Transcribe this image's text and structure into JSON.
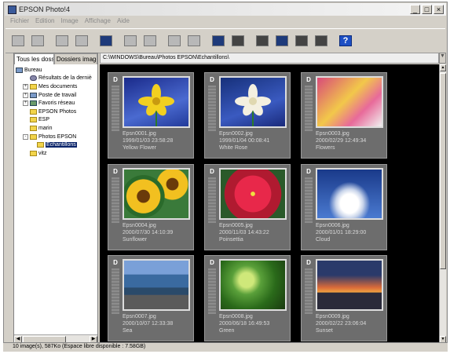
{
  "window": {
    "title": "EPSON Photo!4"
  },
  "menu": [
    "Fichier",
    "Edition",
    "Image",
    "Affichage",
    "Aide"
  ],
  "toolbar_icons": [
    "save-icon",
    "print-icon",
    "blank-icon",
    "copy-icon",
    "frame-icon",
    "prev-icon",
    "next-icon",
    "rotate-left-icon",
    "rotate-right-icon",
    "monitor-icon",
    "slideshow-icon",
    "small-thumbs-icon",
    "medium-thumbs-icon",
    "large-thumbs-icon",
    "list-icon",
    "help-icon"
  ],
  "help_label": "?",
  "tabs": [
    "Tous les dossi",
    "Dossiers image"
  ],
  "tree": [
    {
      "label": "Bureau",
      "icon": "pc",
      "depth": 0,
      "exp": ""
    },
    {
      "label": "Résultats de la derniè",
      "icon": "search",
      "depth": 1,
      "exp": ""
    },
    {
      "label": "Mes documents",
      "icon": "folder",
      "depth": 1,
      "exp": "+"
    },
    {
      "label": "Poste de travail",
      "icon": "pc",
      "depth": 1,
      "exp": "+"
    },
    {
      "label": "Favoris réseau",
      "icon": "net",
      "depth": 1,
      "exp": "+"
    },
    {
      "label": "EPSON Photos",
      "icon": "folder",
      "depth": 1,
      "exp": ""
    },
    {
      "label": "ESP",
      "icon": "folder",
      "depth": 1,
      "exp": ""
    },
    {
      "label": "marin",
      "icon": "folder",
      "depth": 1,
      "exp": ""
    },
    {
      "label": "Photos EPSON",
      "icon": "folder",
      "depth": 1,
      "exp": "-"
    },
    {
      "label": "Echantillons",
      "icon": "folder",
      "depth": 2,
      "exp": "",
      "selected": true
    },
    {
      "label": "vitz",
      "icon": "folder",
      "depth": 1,
      "exp": ""
    }
  ],
  "path": "C:\\WINDOWS\\Bureau\\Photos EPSON\\Echantillons\\",
  "images": [
    {
      "file": "Epsn0001.jpg",
      "date": "1999/01/03  23:58:28",
      "caption": "Yellow Flower",
      "bg": "linear-gradient(160deg,#1a2a8a,#4a6ad0 60%,#223a9a)",
      "subject": "yellow"
    },
    {
      "file": "Epsn0002.jpg",
      "date": "1999/01/04  00:08:41",
      "caption": "White Rose",
      "bg": "linear-gradient(160deg,#16307a,#3a5ac0 60%,#1a2a7a)",
      "subject": "white"
    },
    {
      "file": "Epsn0003.jpg",
      "date": "2000/02/29  12:49:34",
      "caption": "Flowers",
      "bg": "linear-gradient(135deg,#d84a7a,#f2c84a 45%,#e86a9a 70%,#f0f0f0)",
      "subject": "none"
    },
    {
      "file": "Epsn0004.jpg",
      "date": "2000/07/30  14:10:39",
      "caption": "Sunflower",
      "bg": "radial-gradient(circle at 30% 55%,#6a3a0a 0 12%,#f2c020 13% 32%,#2a6a2a 33% 40%,transparent 41%),radial-gradient(circle at 75% 30%,#6a3a0a 0 10%,#f2c020 11% 26%,transparent 27%),#3a7a3a",
      "subject": "none"
    },
    {
      "file": "Epsn0005.jpg",
      "date": "2000/11/03  14:43:22",
      "caption": "Poinsettia",
      "bg": "radial-gradient(circle at 50% 50%,#f0e040 0 5%,#e8284a 6% 45%,#b01a30 46% 70%,#2a5a2a 71%)",
      "subject": "none"
    },
    {
      "file": "Epsn0006.jpg",
      "date": "2000/01/01  18:29:00",
      "caption": "Cloud",
      "bg": "radial-gradient(ellipse at 50% 70%,#ffffff 0 20%,#c8d4ea 30%,transparent 45%),linear-gradient(180deg,#1a3a8a,#4a7ad0)",
      "subject": "none"
    },
    {
      "file": "Epsn0007.jpg",
      "date": "2000/10/07  12:33:38",
      "caption": "Sea",
      "bg": "linear-gradient(180deg,#7aa0d8 0 28%,#3a6aa0 29% 55%,#2a4a6a 56% 70%,#5a5a5a 71%)",
      "subject": "none"
    },
    {
      "file": "Epsn0008.jpg",
      "date": "2000/06/18  16:49:53",
      "caption": "Green",
      "bg": "radial-gradient(circle at 40% 40%,#cfe87a 0 15%,#5aa03a 30%,#2a6a1a 60%,#1a3a10)",
      "subject": "none"
    },
    {
      "file": "Epsn0009.jpg",
      "date": "2000/02/22  23:06:04",
      "caption": "Sunset",
      "bg": "linear-gradient(180deg,#2a3a6a 0 30%,#d86a3a 55%,#f0a040 65%,#2a2a3a 66%)",
      "subject": "none"
    }
  ],
  "status": "10 image(s), 587Ko (Espace libre disponible : 7.58GB)"
}
